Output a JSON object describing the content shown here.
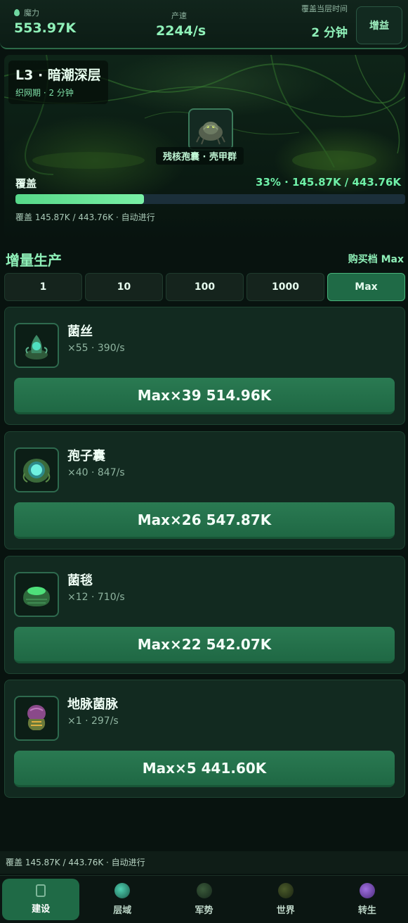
{
  "stats": {
    "mana_label": "魔力",
    "mana_value": "553.97K",
    "rate_label": "产速",
    "rate_value": "2244/s",
    "time_label": "覆盖当层时间",
    "time_value": "2 分钟",
    "boost_label": "增益"
  },
  "level": {
    "title": "L3 · 暗潮深层",
    "subtitle": "织网期 · 2 分钟",
    "enemy_name": "残核孢囊 · 壳甲群",
    "cover_label": "覆盖",
    "cover_stats": "33% · 145.87K / 443.76K",
    "cover_progress": 0.33,
    "cover_detail": "覆盖 145.87K / 443.76K · 自动进行"
  },
  "production": {
    "title": "增量生产",
    "buy_tier_label": "购买档 Max",
    "tiers": [
      "1",
      "10",
      "100",
      "1000",
      "Max"
    ],
    "active_tier": "Max"
  },
  "units": [
    {
      "name": "菌丝",
      "info": "×55 · 390/s",
      "button": "Max×39 514.96K",
      "icon": "mycelium-icon"
    },
    {
      "name": "孢子囊",
      "info": "×40 · 847/s",
      "button": "Max×26 547.87K",
      "icon": "spore-sac-icon"
    },
    {
      "name": "菌毯",
      "info": "×12 · 710/s",
      "button": "Max×22 542.07K",
      "icon": "fungal-mat-icon"
    },
    {
      "name": "地脉菌脉",
      "info": "×1 · 297/s",
      "button": "Max×5 441.60K",
      "icon": "ley-vein-icon"
    }
  ],
  "status_strip": "覆盖 145.87K / 443.76K · 自动进行",
  "nav": [
    {
      "label": "建设",
      "icon": "build-icon"
    },
    {
      "label": "层域",
      "icon": "layer-icon"
    },
    {
      "label": "军势",
      "icon": "army-icon"
    },
    {
      "label": "世界",
      "icon": "world-icon"
    },
    {
      "label": "转生",
      "icon": "rebirth-icon"
    }
  ],
  "colors": {
    "accent": "#8ff0b8",
    "button": "#1f6a46",
    "progress": "#57d889"
  }
}
